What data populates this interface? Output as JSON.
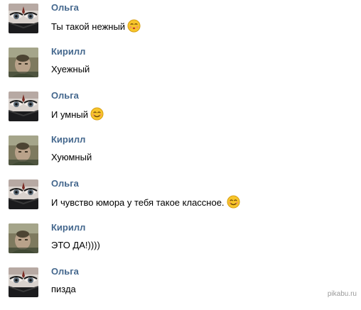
{
  "messages": [
    {
      "author": "Ольга",
      "text": "Ты такой нежный",
      "emoji": "kissing-face-icon"
    },
    {
      "author": "Кирилл",
      "text": "Хуежный",
      "emoji": ""
    },
    {
      "author": "Ольга",
      "text": "И умный",
      "emoji": "smiling-face-icon"
    },
    {
      "author": "Кирилл",
      "text": "Хуюмный",
      "emoji": ""
    },
    {
      "author": "Ольга",
      "text": "И чувство юмора у тебя такое классное.",
      "emoji": "smiling-face-icon"
    },
    {
      "author": "Кирилл",
      "text": "ЭТО ДА!))))",
      "emoji": ""
    },
    {
      "author": "Ольга",
      "text": "пизда",
      "emoji": ""
    }
  ],
  "watermark": "pikabu.ru",
  "colors": {
    "author_name": "#45688e",
    "message_text": "#000000",
    "emoji_face": "#f7c52a"
  }
}
